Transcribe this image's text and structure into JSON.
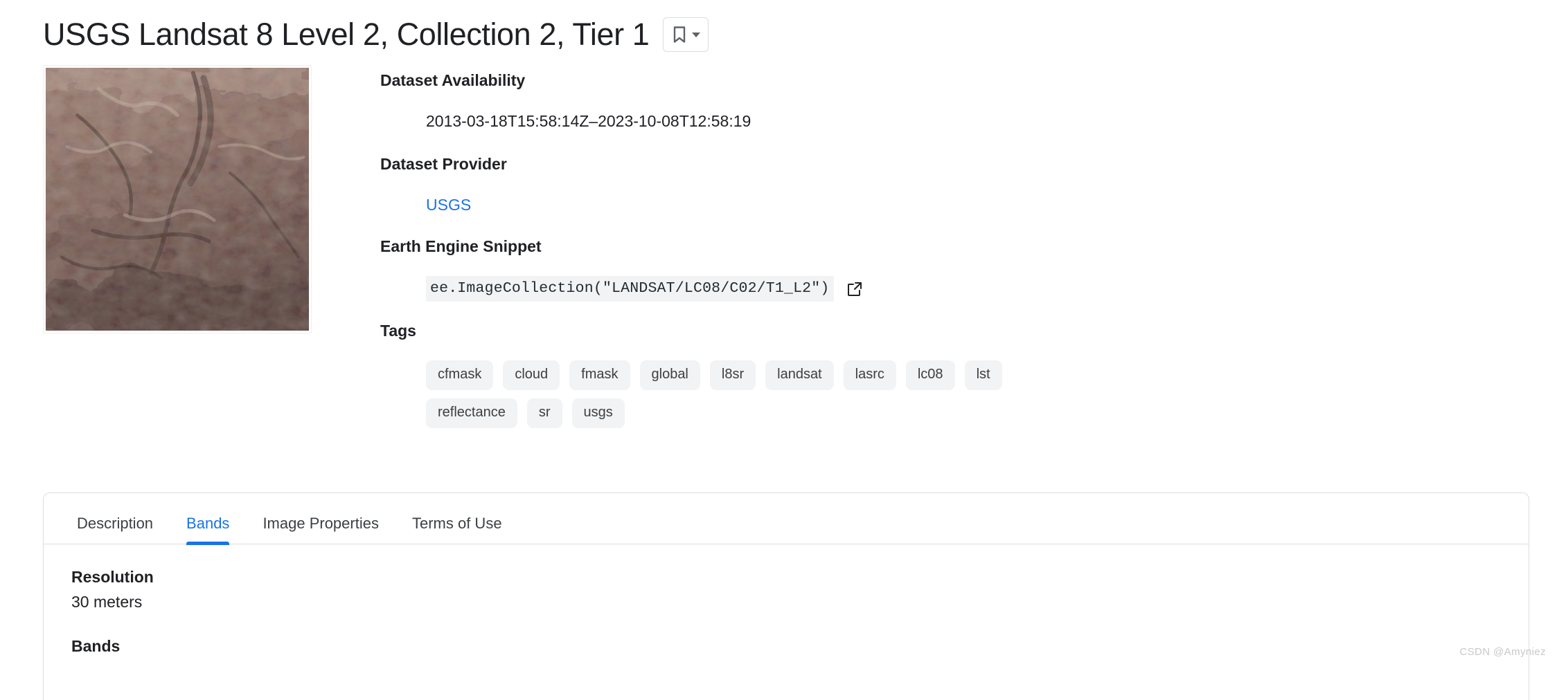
{
  "header": {
    "title": "USGS Landsat 8 Level 2, Collection 2, Tier 1",
    "bookmark_icon": "bookmark-icon",
    "dropdown_icon": "chevron-down-icon"
  },
  "thumbnail": {
    "alt": "landsat-satellite-terrain-thumbnail",
    "palette": [
      "#9c7f75",
      "#7d6159",
      "#b49b8e",
      "#5d4942",
      "#c9b4a6"
    ]
  },
  "details": {
    "availability": {
      "label": "Dataset Availability",
      "value": "2013-03-18T15:58:14Z–2023-10-08T12:58:19"
    },
    "provider": {
      "label": "Dataset Provider",
      "value": "USGS"
    },
    "snippet": {
      "label": "Earth Engine Snippet",
      "code": "ee.ImageCollection(\"LANDSAT/LC08/C02/T1_L2\")",
      "open_icon": "external-link-icon"
    },
    "tags": {
      "label": "Tags",
      "items": [
        "cfmask",
        "cloud",
        "fmask",
        "global",
        "l8sr",
        "landsat",
        "lasrc",
        "lc08",
        "lst",
        "reflectance",
        "sr",
        "usgs"
      ]
    }
  },
  "tabs": {
    "items": [
      {
        "label": "Description",
        "active": false
      },
      {
        "label": "Bands",
        "active": true
      },
      {
        "label": "Image Properties",
        "active": false
      },
      {
        "label": "Terms of Use",
        "active": false
      }
    ]
  },
  "bands_panel": {
    "resolution_label": "Resolution",
    "resolution_value": "30 meters",
    "bands_label": "Bands"
  },
  "watermark": "CSDN @Amyniez",
  "colors": {
    "link": "#1a73e8",
    "accent": "#1a73e8",
    "text": "#202124",
    "chip_bg": "#f1f3f4",
    "border": "#dadce0"
  }
}
